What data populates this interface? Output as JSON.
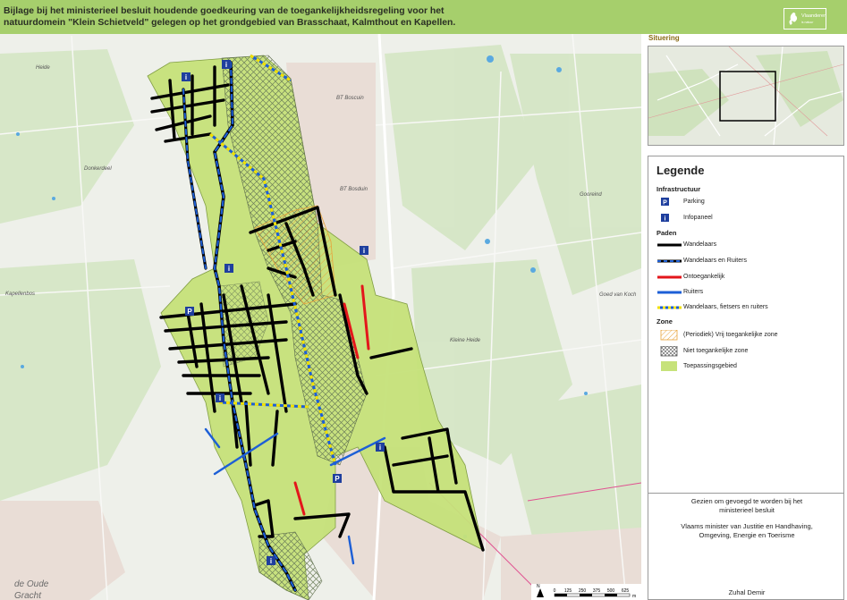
{
  "header": {
    "title": "Bijlage bij het ministerieel besluit houdende goedkeuring van de toegankelijkheidsregeling voor het\n natuurdomein \"Klein Schietveld\" gelegen op het grondgebied van Brasschaat, Kalmthout en Kapellen.",
    "logo_text": "Vlaanderen",
    "logo_subtext": "is natuur"
  },
  "map": {
    "place_labels": [
      "Heide",
      "BT Boscuin",
      "BT Bosduin",
      "Donkerdeel",
      "Gooreind",
      "Kapellenbos",
      "Goed van Koch",
      "Kleine Heide",
      "de Oude",
      "Gracht"
    ],
    "scale_ticks": [
      "0",
      "125",
      "250",
      "375",
      "500",
      "625"
    ],
    "scale_unit": "m",
    "north_letter": "N"
  },
  "situering": {
    "title": "Situering"
  },
  "legend": {
    "title": "Legende",
    "sections": {
      "infra": "Infrastructuur",
      "paden": "Paden",
      "zone": "Zone"
    },
    "items": {
      "parking": "Parking",
      "infopaneel": "Infopaneel",
      "wandelaars": "Wandelaars",
      "wandelaars_ruiters": "Wandelaars en Ruiters",
      "ontoegankelijk": "Ontoegankelijk",
      "ruiters": "Ruiters",
      "wfr": "Wandelaars, fietsers en ruiters",
      "periodiek": "(Periodiek) Vrij toegankelijke zone",
      "niet_toeg": "Niet toegankelijke zone",
      "toepassing": "Toepassingsgebied"
    },
    "icons": {
      "parking": "P",
      "info": "i"
    }
  },
  "approval": {
    "line1": "Gezien om gevoegd te worden bij het\nministerieel besluit",
    "line2": "Vlaams minister van Justitie en Handhaving,\nOmgeving, Energie en Toerisme",
    "signer": "Zuhal Demir"
  },
  "colors": {
    "header": "#a6cf6c",
    "application_area": "#c6e27a",
    "walk": "#000000",
    "ride": "#1d5fd6",
    "closed": "#e3161b",
    "shared_yellow": "#f2e100",
    "periodic_hatch": "#e8a33a"
  }
}
